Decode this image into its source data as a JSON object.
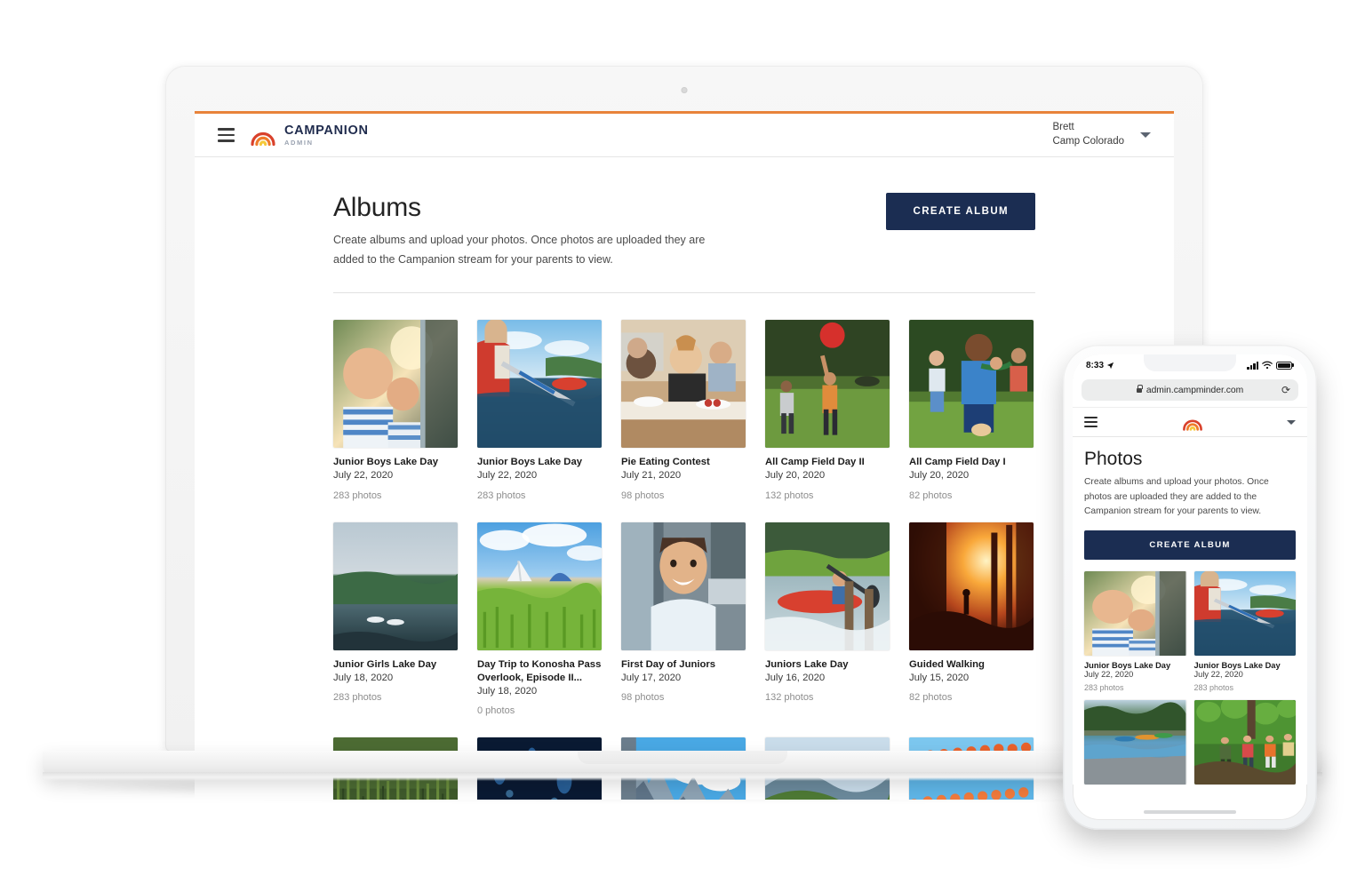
{
  "brand": {
    "name": "CAMPANION",
    "sub": "ADMIN",
    "logo_icon": "campanion-arch-logo-icon",
    "accent_color": "#e8833a",
    "primary_color": "#1b2d52"
  },
  "desktop": {
    "nav": {
      "menu_icon": "hamburger-menu-icon",
      "user_name": "Brett",
      "user_org": "Camp Colorado",
      "chevron_icon": "chevron-down-icon"
    },
    "header": {
      "title": "Albums",
      "description": "Create albums and upload your photos. Once photos are uploaded they are added to the Campanion stream for your parents to view.",
      "create_button": "CREATE ALBUM"
    },
    "albums": [
      {
        "title": "Junior Boys Lake Day",
        "date": "July 22, 2020",
        "count": "283 photos",
        "image": "boy-smiling-on-boat"
      },
      {
        "title": "Junior Boys Lake Day",
        "date": "July 22, 2020",
        "count": "283 photos",
        "image": "canoe-paddling-river"
      },
      {
        "title": "Pie Eating Contest",
        "date": "July 21, 2020",
        "count": "98 photos",
        "image": "kids-eating-pie-table"
      },
      {
        "title": "All Camp Field Day II",
        "date": "July 20, 2020",
        "count": "132 photos",
        "image": "child-catching-red-ball"
      },
      {
        "title": "All Camp Field Day I",
        "date": "July 20, 2020",
        "count": "82 photos",
        "image": "kids-running-field-game"
      },
      {
        "title": "Junior Girls Lake Day",
        "date": "July 18, 2020",
        "count": "283 photos",
        "image": "lake-with-boats-shoreline"
      },
      {
        "title": "Day Trip to Konosha Pass Overlook, Episode II...",
        "date": "July 18, 2020",
        "count": "0 photos",
        "image": "tents-in-grass-field"
      },
      {
        "title": "First Day of Juniors",
        "date": "July 17, 2020",
        "count": "98 photos",
        "image": "boy-in-white-shirt-smiling"
      },
      {
        "title": "Juniors Lake Day",
        "date": "July 16, 2020",
        "count": "132 photos",
        "image": "red-kayak-on-water"
      },
      {
        "title": "Guided Walking",
        "date": "July 15, 2020",
        "count": "82 photos",
        "image": "sunset-forest-silhouette"
      },
      {
        "title": "",
        "date": "",
        "count": "",
        "image": "dense-green-grass"
      },
      {
        "title": "",
        "date": "",
        "count": "",
        "image": "dark-blue-night-water"
      },
      {
        "title": "",
        "date": "",
        "count": "",
        "image": "mountain-cliff-blue-sky"
      },
      {
        "title": "",
        "date": "",
        "count": "",
        "image": "green-hills-landscape"
      },
      {
        "title": "",
        "date": "",
        "count": "",
        "image": "pool-lane-swimming"
      }
    ]
  },
  "phone": {
    "status": {
      "time": "8:33",
      "location_icon": "location-arrow-icon",
      "signal_icon": "cellular-signal-icon",
      "wifi_icon": "wifi-icon",
      "battery_icon": "battery-full-icon"
    },
    "url": {
      "text": "admin.campminder.com",
      "lock_icon": "lock-icon",
      "reload_icon": "reload-icon"
    },
    "nav": {
      "menu_icon": "hamburger-menu-icon",
      "logo_icon": "campanion-arch-logo-icon",
      "chevron_icon": "chevron-down-icon"
    },
    "header": {
      "title": "Photos",
      "description": "Create albums and upload your photos. Once photos are uploaded they are added to the Campanion stream for your parents to view.",
      "create_button": "CREATE ALBUM"
    },
    "albums": [
      {
        "title": "Junior Boys Lake Day",
        "date": "July 22, 2020",
        "count": "283 photos",
        "image": "boy-smiling-on-boat"
      },
      {
        "title": "Junior Boys Lake Day",
        "date": "July 22, 2020",
        "count": "283 photos",
        "image": "canoe-paddling-river"
      },
      {
        "title": "",
        "date": "",
        "count": "",
        "image": "lake-with-kayaks-rocks"
      },
      {
        "title": "",
        "date": "",
        "count": "",
        "image": "kids-hiking-green-forest"
      }
    ]
  }
}
